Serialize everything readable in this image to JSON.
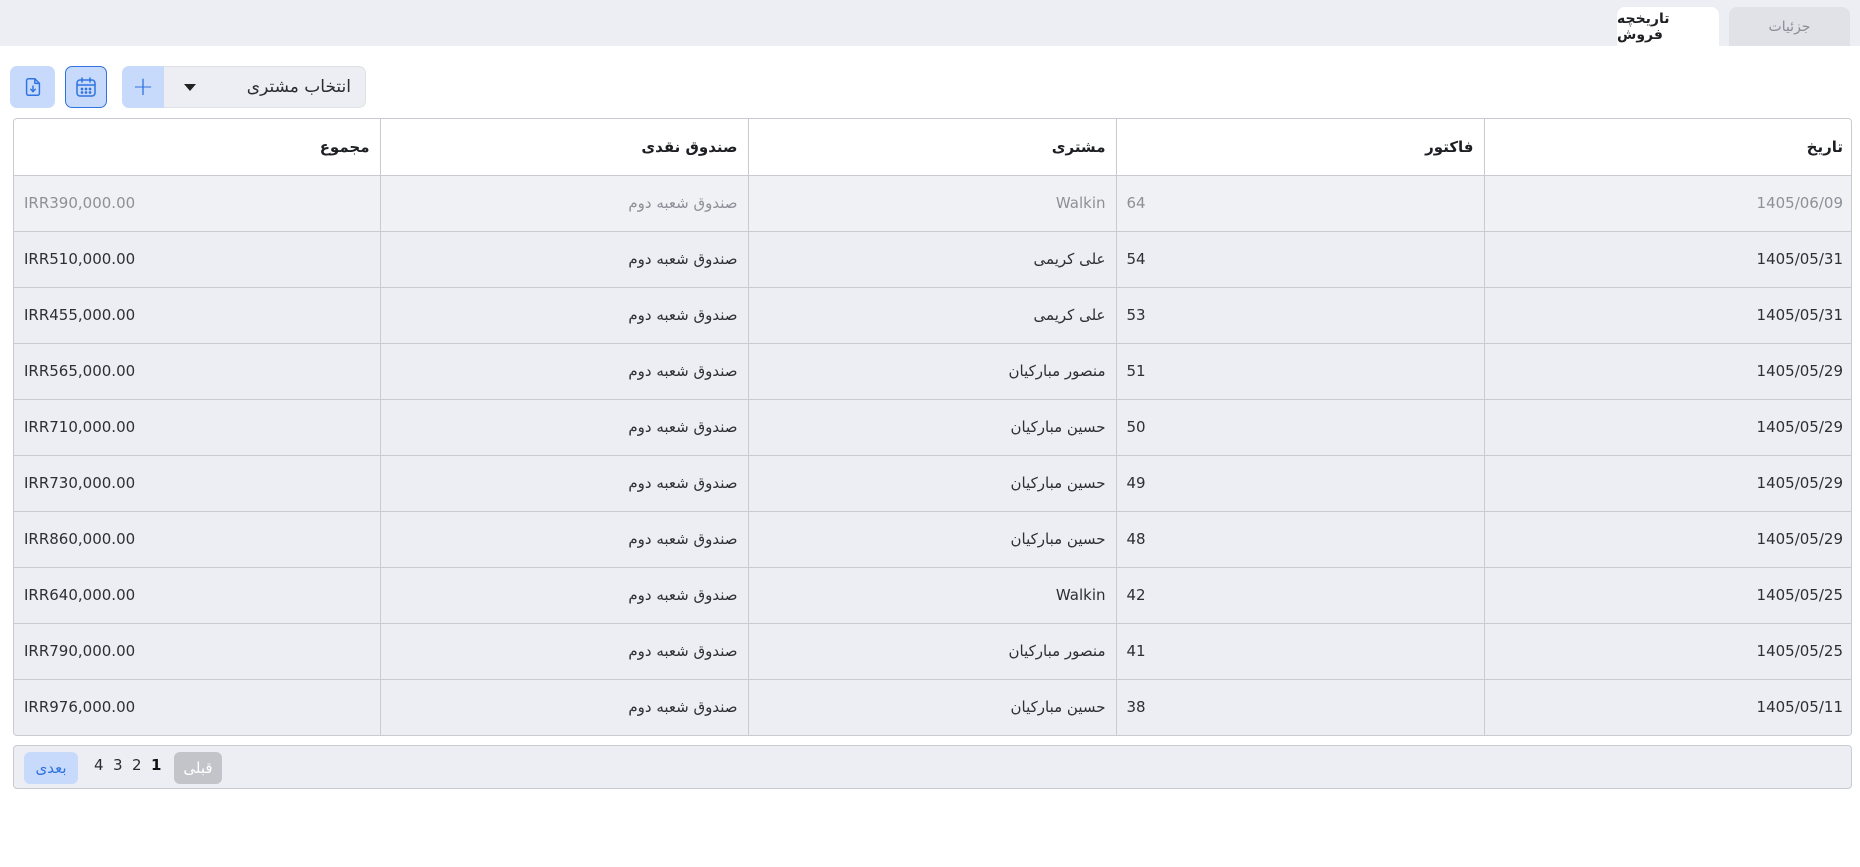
{
  "tabs": [
    {
      "label": "جزئیات",
      "active": false
    },
    {
      "label": "تاریخچه فروش",
      "active": true
    }
  ],
  "toolbar": {
    "customer_select_label": "انتخاب مشتری",
    "add_icon": "plus-icon",
    "calendar_icon": "calendar-icon",
    "export_icon": "file-export-icon"
  },
  "table": {
    "headers": {
      "date": "تاریخ",
      "invoice": "فاکتور",
      "customer": "مشتری",
      "cash_box": "صندوق نقدی",
      "total": "مجموع"
    },
    "rows": [
      {
        "date": "1405/06/09",
        "invoice": "64",
        "customer": "Walkin",
        "cash_box": "صندوق شعبه دوم",
        "total": "IRR390,000.00"
      },
      {
        "date": "1405/05/31",
        "invoice": "54",
        "customer": "علی کریمی",
        "cash_box": "صندوق شعبه دوم",
        "total": "IRR510,000.00"
      },
      {
        "date": "1405/05/31",
        "invoice": "53",
        "customer": "علی کریمی",
        "cash_box": "صندوق شعبه دوم",
        "total": "IRR455,000.00"
      },
      {
        "date": "1405/05/29",
        "invoice": "51",
        "customer": "منصور مبارکیان",
        "cash_box": "صندوق شعبه دوم",
        "total": "IRR565,000.00"
      },
      {
        "date": "1405/05/29",
        "invoice": "50",
        "customer": "حسین مبارکیان",
        "cash_box": "صندوق شعبه دوم",
        "total": "IRR710,000.00"
      },
      {
        "date": "1405/05/29",
        "invoice": "49",
        "customer": "حسین مبارکیان",
        "cash_box": "صندوق شعبه دوم",
        "total": "IRR730,000.00"
      },
      {
        "date": "1405/05/29",
        "invoice": "48",
        "customer": "حسین مبارکیان",
        "cash_box": "صندوق شعبه دوم",
        "total": "IRR860,000.00"
      },
      {
        "date": "1405/05/25",
        "invoice": "42",
        "customer": "Walkin",
        "cash_box": "صندوق شعبه دوم",
        "total": "IRR640,000.00"
      },
      {
        "date": "1405/05/25",
        "invoice": "41",
        "customer": "منصور مبارکیان",
        "cash_box": "صندوق شعبه دوم",
        "total": "IRR790,000.00"
      },
      {
        "date": "1405/05/11",
        "invoice": "38",
        "customer": "حسین مبارکیان",
        "cash_box": "صندوق شعبه دوم",
        "total": "IRR976,000.00"
      }
    ]
  },
  "pagination": {
    "next_label": "بعدی",
    "prev_label": "قبلی",
    "pages": [
      "4",
      "3",
      "2",
      "1"
    ],
    "current": "1"
  },
  "colors": {
    "accent": "#2f73e0",
    "accent_soft": "#c8dafb",
    "panel": "#eceef4",
    "border": "#c9cbd1"
  }
}
